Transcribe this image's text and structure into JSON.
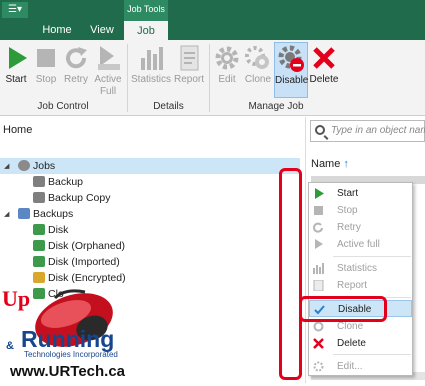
{
  "titlebar": {
    "context_group": "Job Tools",
    "menu_label": "☰▾"
  },
  "tabs": [
    {
      "label": "Home"
    },
    {
      "label": "View"
    },
    {
      "label": "Job"
    }
  ],
  "ribbon": {
    "buttons": [
      {
        "label": "Start"
      },
      {
        "label": "Stop"
      },
      {
        "label": "Retry"
      },
      {
        "label": "Active Full"
      },
      {
        "label": "Statistics"
      },
      {
        "label": "Report"
      },
      {
        "label": "Edit"
      },
      {
        "label": "Clone"
      },
      {
        "label": "Disable"
      },
      {
        "label": "Delete"
      }
    ],
    "groups": [
      "Job Control",
      "Details",
      "Manage Job"
    ]
  },
  "nav": {
    "home": "Home",
    "tree": [
      {
        "label": "Jobs"
      },
      {
        "label": "Backup"
      },
      {
        "label": "Backup Copy"
      },
      {
        "label": "Backups"
      },
      {
        "label": "Disk"
      },
      {
        "label": "Disk (Orphaned)"
      },
      {
        "label": "Disk (Imported)"
      },
      {
        "label": "Disk (Encrypted)"
      },
      {
        "label": "Clo"
      }
    ]
  },
  "search": {
    "placeholder": "Type in an object name"
  },
  "list": {
    "column_name": "Name",
    "sort_arrow": "↑"
  },
  "context_menu": {
    "items": [
      {
        "label": "Start"
      },
      {
        "label": "Stop"
      },
      {
        "label": "Retry"
      },
      {
        "label": "Active full"
      },
      {
        "label": "Statistics"
      },
      {
        "label": "Report"
      },
      {
        "label": "Disable"
      },
      {
        "label": "Clone"
      },
      {
        "label": "Delete"
      },
      {
        "label": "Edit..."
      }
    ]
  },
  "watermark": {
    "up": "Up",
    "running": "Running",
    "amp": "&",
    "tagline": "Technologies Incorporated",
    "url": "www.URTech.ca"
  },
  "colors": {
    "brand_green": "#1f6b4b",
    "highlight_blue": "#cde6f7",
    "annotation_red": "#e3001b"
  }
}
